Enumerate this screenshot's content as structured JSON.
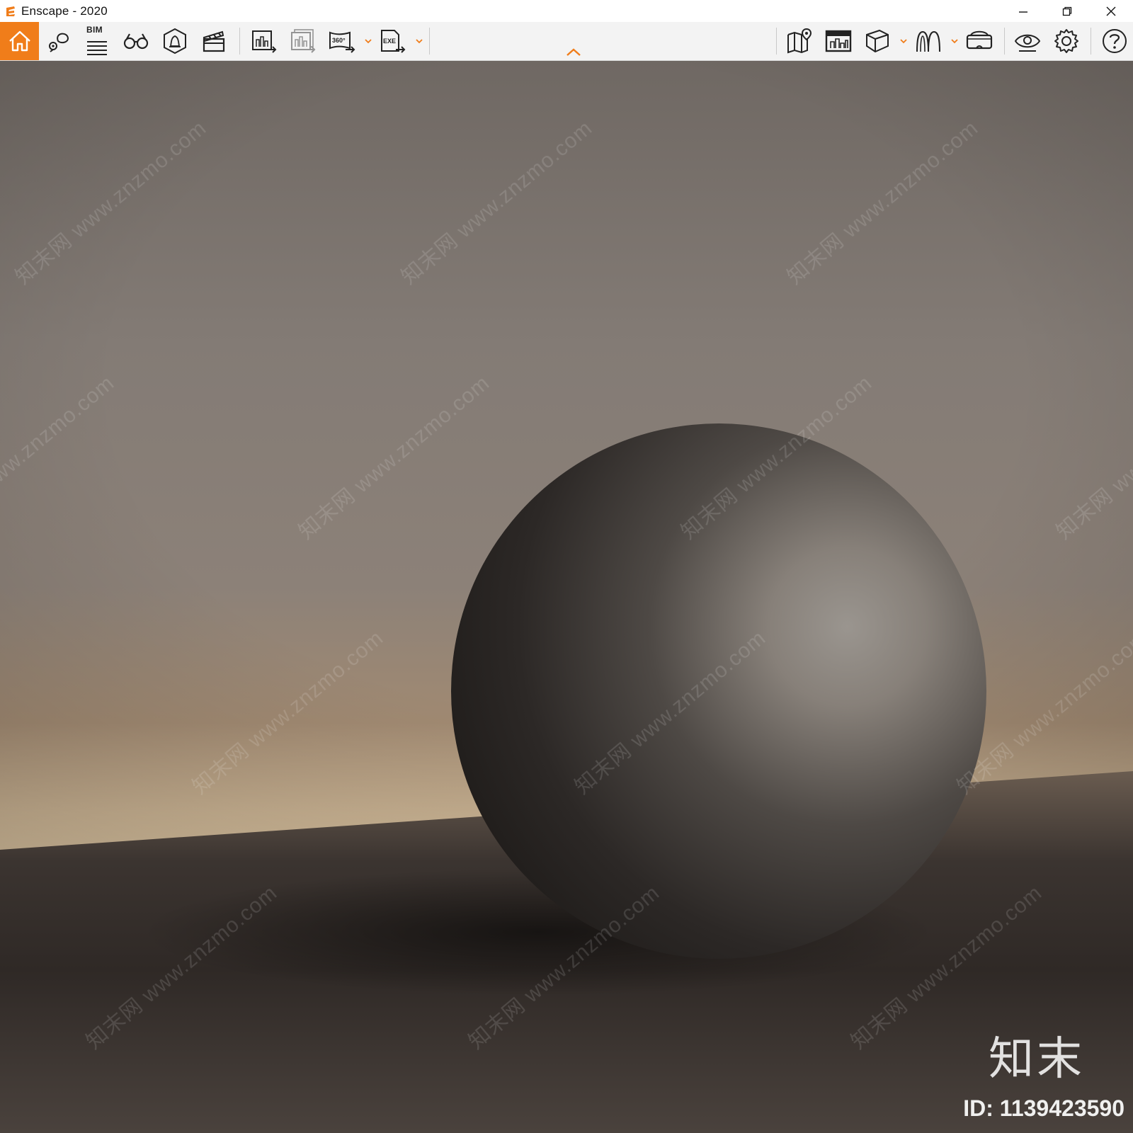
{
  "window": {
    "title": "Enscape - 2020",
    "controls": [
      "minimize-icon",
      "restore-icon",
      "close-icon"
    ]
  },
  "toolbar": {
    "bim_label": "BIM",
    "text_360": "360°",
    "text_exe": "EXE",
    "left_tools": [
      {
        "name": "home-icon",
        "active": true
      },
      {
        "name": "views-pin-icon"
      },
      {
        "name": "bim-list-icon"
      },
      {
        "name": "binoculars-icon"
      },
      {
        "name": "atmosphere-bell-icon"
      },
      {
        "name": "clapperboard-icon"
      },
      {
        "name": "export-image-icon"
      },
      {
        "name": "batch-export-icon"
      },
      {
        "name": "export-360-icon",
        "dropdown": true
      },
      {
        "name": "export-exe-icon",
        "dropdown": true
      }
    ],
    "right_tools": [
      {
        "name": "map-icon"
      },
      {
        "name": "web-export-icon"
      },
      {
        "name": "cube-icon",
        "dropdown": true
      },
      {
        "name": "asset-library-icon",
        "dropdown": true
      },
      {
        "name": "vr-headset-icon"
      },
      {
        "name": "eye-icon"
      },
      {
        "name": "settings-gear-icon"
      },
      {
        "name": "help-icon"
      }
    ],
    "collapse_icon": "chevron-up-icon"
  },
  "colors": {
    "accent": "#f07d1a",
    "wall": "#7a736d",
    "floor": "#4a4440",
    "sphere": "#5a5550"
  },
  "overlay": {
    "watermark_text": "知末网 www.znzmo.com",
    "brand": "知末",
    "id_label": "ID: 1139423590"
  }
}
